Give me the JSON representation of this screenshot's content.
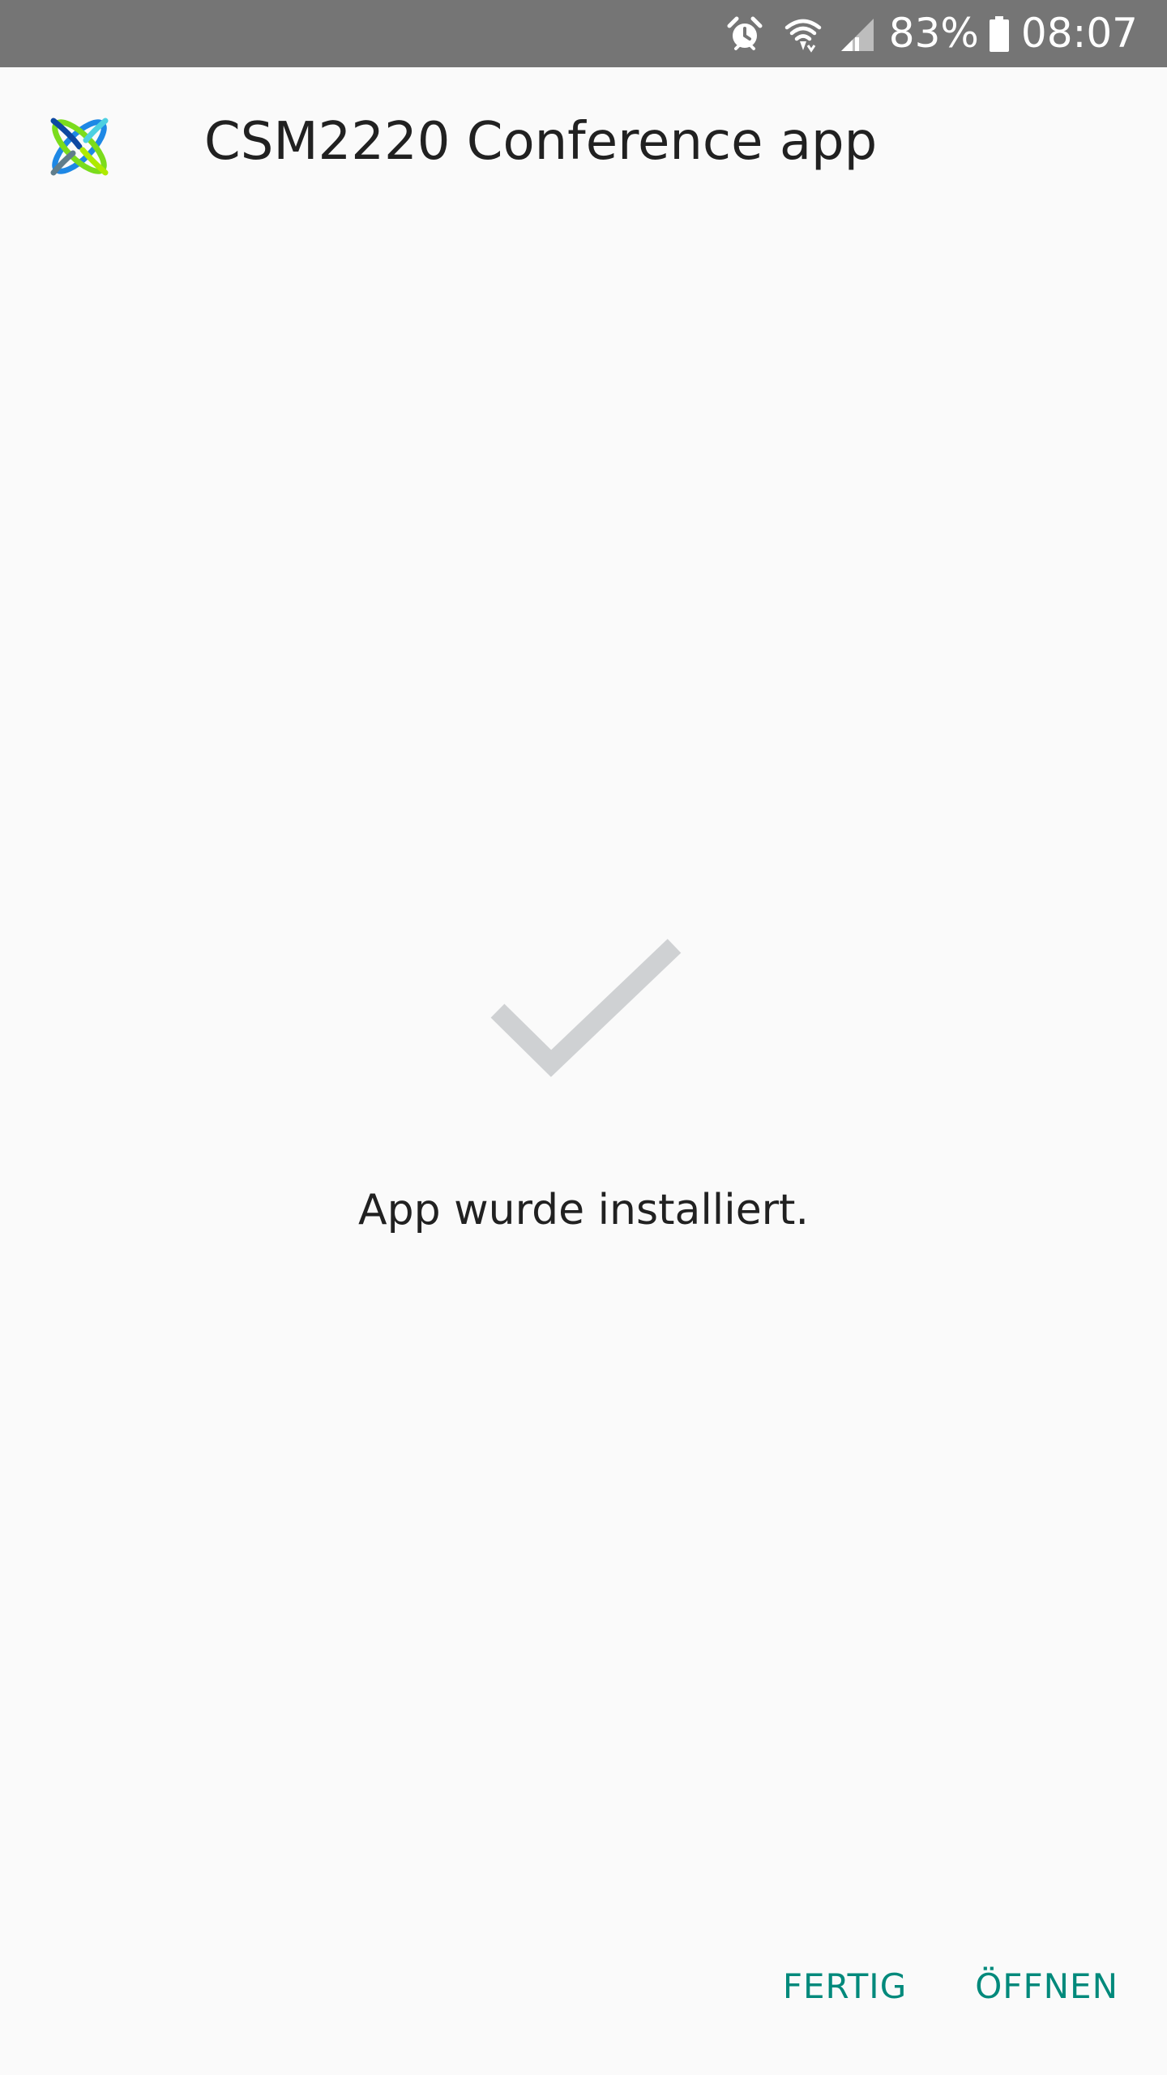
{
  "status_bar": {
    "battery_percent": "83%",
    "time": "08:07",
    "icons": [
      "alarm-icon",
      "wifi-icon",
      "signal-icon",
      "battery-icon"
    ],
    "background_color": "#757575"
  },
  "header": {
    "app_name": "CSM2220 Conference app",
    "logo_icon": "app-logo-icon"
  },
  "install_result": {
    "icon": "checkmark-icon",
    "message": "App wurde installiert."
  },
  "actions": {
    "done_label": "FERTIG",
    "open_label": "ÖFFNEN"
  },
  "colors": {
    "accent": "#00897b",
    "check_gray": "#cfd1d3",
    "background": "#fafafa",
    "text": "#212121"
  }
}
